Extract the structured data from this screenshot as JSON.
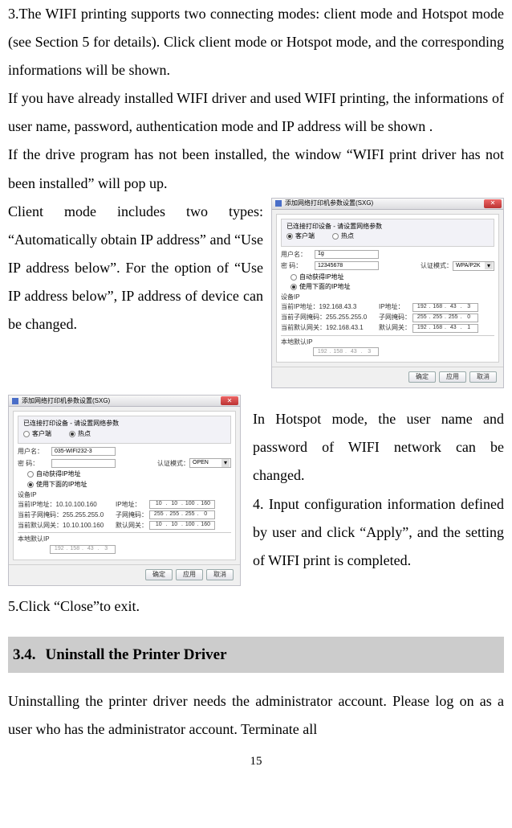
{
  "para1": "3.The WIFI printing supports two connecting modes: client mode and Hotspot mode (see Section 5 for details). Click client mode or Hotspot mode, and the corresponding informations will be shown.",
  "para2": "If you have already installed WIFI driver and used WIFI printing, the informations of user name, password, authentication mode and IP address will be shown .",
  "para3": "If the drive program has not been installed, the window “WIFI print driver has not been installed” will pop up.",
  "para4": "Client mode includes two types: “Automatically obtain IP address” and “Use IP address below”. For the option of “Use IP address below”, IP address of device can be changed.",
  "para5": "In Hotspot mode, the user name and password of WIFI network can be changed.",
  "para6": "4. Input configuration information defined by user and click “Apply”, and the setting of WIFI print is completed.",
  "para7": "5.Click “Close”to exit.",
  "section_num": "3.4.",
  "section_title": "Uninstall the Printer Driver",
  "para8": "Uninstalling the printer driver needs the administrator account. Please log on as a user who has the administrator account. Terminate all",
  "page_number": "15",
  "figA": {
    "title": "添加网络打印机参数设置(SXG)",
    "subtitle": "已连接打印设备 - 请设置网络参数",
    "radio_client": "客户端",
    "radio_hotspot": "热点",
    "user_label": "用户名：",
    "user_value": "1g",
    "pass_label": "密  码：",
    "pass_value": "12345678",
    "auth_label": "认证模式：",
    "auth_value": "WPA/P2K",
    "radio_auto": "自动获得IP地址",
    "radio_manual": "使用下面的IP地址",
    "dev_ip_title": "设备IP",
    "cur_ip_label": "当前IP地址：192.168.43.3",
    "cur_subnet_label": "当前子网掩码：255.255.255.0",
    "cur_gw_label": "当前默认网关：192.168.43.1",
    "ip_label": "IP地址：",
    "subnet_label": "子网掩码：",
    "gw_label": "默认网关：",
    "ip_v": [
      "192",
      "168",
      "43",
      "3"
    ],
    "subnet_v": [
      "255",
      "255",
      "255",
      "0"
    ],
    "gw_v": [
      "192",
      "168",
      "43",
      "1"
    ],
    "local_ip_title": "本地默认IP",
    "local_v": [
      "192",
      "158",
      "43",
      "3"
    ],
    "btn_ok": "确定",
    "btn_apply": "应用",
    "btn_cancel": "取消"
  },
  "figB": {
    "title": "添加网络打印机参数设置(SXG)",
    "subtitle": "已连接打印设备 - 请设置网络参数",
    "radio_client": "客户端",
    "radio_hotspot": "热点",
    "user_label": "用户名：",
    "user_value": "035-WIFI232-3",
    "pass_label": "密  码：",
    "pass_value": "",
    "auth_label": "认证模式：",
    "auth_value": "OPEN",
    "radio_auto": "自动获得IP地址",
    "radio_manual": "使用下面的IP地址",
    "dev_ip_title": "设备IP",
    "cur_ip_label": "当前IP地址：10.10.100.160",
    "cur_subnet_label": "当前子网掩码：255.255.255.0",
    "cur_gw_label": "当前默认网关：10.10.100.160",
    "ip_label": "IP地址：",
    "subnet_label": "子网掩码：",
    "gw_label": "默认网关：",
    "ip_v": [
      "10",
      "10",
      "100",
      "160"
    ],
    "subnet_v": [
      "255",
      "255",
      "255",
      "0"
    ],
    "gw_v": [
      "10",
      "10",
      "100",
      "160"
    ],
    "local_ip_title": "本地默认IP",
    "local_v": [
      "192",
      "158",
      "43",
      "3"
    ],
    "btn_ok": "确定",
    "btn_apply": "应用",
    "btn_cancel": "取消"
  }
}
